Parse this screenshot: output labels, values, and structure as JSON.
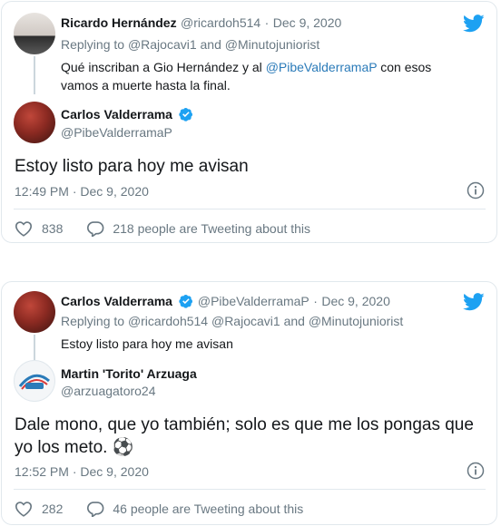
{
  "tweet1": {
    "parent": {
      "name": "Ricardo Hernández",
      "handle": "@ricardoh514",
      "separator": "·",
      "date": "Dec 9, 2020",
      "replying_prefix": "Replying to",
      "replying_to_1": "@Rajocavi1",
      "replying_and": "and",
      "replying_to_2": "@Minutojuniorist",
      "text_part1": "Qué inscriban a Gio Hernández y al",
      "mention": "@PibeValderramaP",
      "text_part2": "con esos",
      "text_line2": "vamos a muerte hasta la final."
    },
    "main": {
      "name": "Carlos Valderrama",
      "handle": "@PibeValderramaP",
      "text": "Estoy listo para hoy me avisan",
      "time": "12:49 PM",
      "separator": "·",
      "date": "Dec 9, 2020",
      "likes": "838",
      "tweeting_count": "218 people are Tweeting about this"
    }
  },
  "tweet2": {
    "parent": {
      "name": "Carlos Valderrama",
      "handle": "@PibeValderramaP",
      "separator": "·",
      "date": "Dec 9, 2020",
      "replying_prefix": "Replying to",
      "replying_to_1": "@ricardoh514",
      "replying_to_2": "@Rajocavi1",
      "replying_and": "and",
      "replying_to_3": "@Minutojuniorist",
      "text": "Estoy listo para hoy me avisan"
    },
    "main": {
      "name": "Martin 'Torito' Arzuaga",
      "handle": "@arzuagatoro24",
      "text_line1": "Dale mono, que yo también; solo es que me los pongas que",
      "text_line2": "yo los meto.",
      "emoji": "⚽",
      "time": "12:52 PM",
      "separator": "·",
      "date": "Dec 9, 2020",
      "likes": "282",
      "tweeting_count": "46 people are Tweeting about this"
    }
  },
  "colors": {
    "twitter_blue": "#1da1f2",
    "link_blue": "#2b7bb9",
    "muted_gray": "#697882",
    "border": "#e1e8ed"
  },
  "icons": [
    "twitter-bird-icon",
    "verified-badge-icon",
    "info-icon",
    "heart-icon",
    "reply-bubble-icon"
  ]
}
